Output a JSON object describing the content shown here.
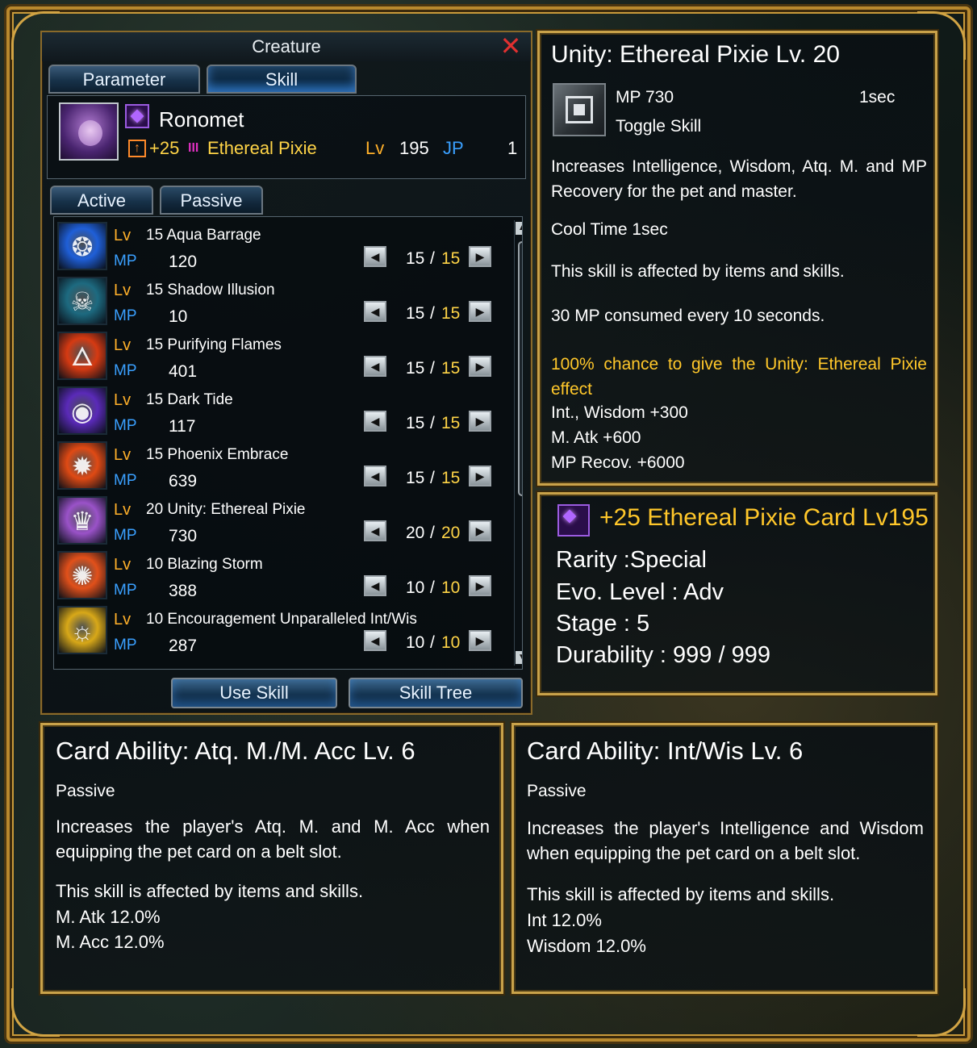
{
  "window": {
    "title": "Creature",
    "tabs": [
      "Parameter",
      "Skill"
    ],
    "subtabs": [
      "Active",
      "Passive"
    ],
    "creature": {
      "name": "Ronomet",
      "plus": "+25",
      "grade_glyph": "III",
      "type_name": "Ethereal Pixie",
      "lv_label": "Lv",
      "lv": "195",
      "jp_label": "JP",
      "jp": "1"
    },
    "skills": [
      {
        "lv_label": "Lv",
        "lv": "15",
        "name": "Aqua Barrage",
        "mp_label": "MP",
        "mp": "120",
        "cur": "15",
        "sep": "/",
        "max": "15",
        "icon": "water-spell-icon",
        "color": "#1f5fd8"
      },
      {
        "lv_label": "Lv",
        "lv": "15",
        "name": "Shadow Illusion",
        "mp_label": "MP",
        "mp": "10",
        "cur": "15",
        "sep": "/",
        "max": "15",
        "icon": "shadow-beast-icon",
        "color": "#1d6a80"
      },
      {
        "lv_label": "Lv",
        "lv": "15",
        "name": "Purifying Flames",
        "mp_label": "MP",
        "mp": "401",
        "cur": "15",
        "sep": "/",
        "max": "15",
        "icon": "flame-icon",
        "color": "#d63a12"
      },
      {
        "lv_label": "Lv",
        "lv": "15",
        "name": "Dark Tide",
        "mp_label": "MP",
        "mp": "117",
        "cur": "15",
        "sep": "/",
        "max": "15",
        "icon": "vortex-icon",
        "color": "#5a2ab8"
      },
      {
        "lv_label": "Lv",
        "lv": "15",
        "name": "Phoenix Embrace",
        "mp_label": "MP",
        "mp": "639",
        "cur": "15",
        "sep": "/",
        "max": "15",
        "icon": "phoenix-icon",
        "color": "#e04a14"
      },
      {
        "lv_label": "Lv",
        "lv": "20",
        "name": "Unity: Ethereal Pixie",
        "mp_label": "MP",
        "mp": "730",
        "cur": "20",
        "sep": "/",
        "max": "20",
        "icon": "pixie-portrait-icon",
        "color": "#9a52c8"
      },
      {
        "lv_label": "Lv",
        "lv": "10",
        "name": "Blazing Storm",
        "mp_label": "MP",
        "mp": "388",
        "cur": "10",
        "sep": "/",
        "max": "10",
        "icon": "fire-burst-icon",
        "color": "#e2501a"
      },
      {
        "lv_label": "Lv",
        "lv": "10",
        "name": "Encouragement Unparalleled Int/Wis",
        "mp_label": "MP",
        "mp": "287",
        "cur": "10",
        "sep": "/",
        "max": "10",
        "icon": "golden-dragon-icon",
        "color": "#d8a818"
      }
    ],
    "buttons": {
      "use_skill": "Use Skill",
      "skill_tree": "Skill Tree"
    },
    "icons": {
      "close": "close-icon",
      "left_arrow": "◀",
      "right_arrow": "▶",
      "scroll_up": "▲",
      "scroll_down": "▼"
    }
  },
  "skill_tooltip": {
    "title": "Unity: Ethereal Pixie Lv. 20",
    "mp": "MP 730",
    "cast": "1sec",
    "kind": "Toggle Skill",
    "desc": "Increases Intelligence, Wisdom, Atq. M. and MP Recovery for the pet and master.",
    "cool": "Cool Time 1sec",
    "affected": "This skill is affected by items and skills.",
    "consume": "30 MP consumed every 10 seconds.",
    "chance": "100% chance to give the Unity: Ethereal Pixie effect",
    "stat1": "Int., Wisdom +300",
    "stat2": "M. Atk +600",
    "stat3": "MP Recov. +6000"
  },
  "card_tooltip": {
    "title": "+25 Ethereal Pixie Card Lv195",
    "rarity": "Rarity :Special",
    "evo": "Evo. Level : Adv",
    "stage": "Stage : 5",
    "durability": "Durability : 999 / 999"
  },
  "ability_left": {
    "title": "Card Ability: Atq. M./M. Acc Lv. 6",
    "kind": "Passive",
    "desc": "Increases the player's Atq. M. and M. Acc when equipping the pet card on a belt slot.",
    "affected": "This skill is affected by items and skills.",
    "stat1": "M. Atk 12.0%",
    "stat2": "M. Acc 12.0%"
  },
  "ability_right": {
    "title": "Card Ability: Int/Wis Lv. 6",
    "kind": "Passive",
    "desc": "Increases the player's Intelligence and Wisdom when equipping the pet card on a belt slot.",
    "affected": "This skill is affected by items and skills.",
    "stat1": "Int 12.0%",
    "stat2": "Wisdom 12.0%"
  },
  "colors": {
    "gold": "#ffc72a",
    "mp_blue": "#3aa0ff",
    "lv_orange": "#ffb02a",
    "close_red": "#e03030",
    "frame_gold": "#c9a24a"
  }
}
